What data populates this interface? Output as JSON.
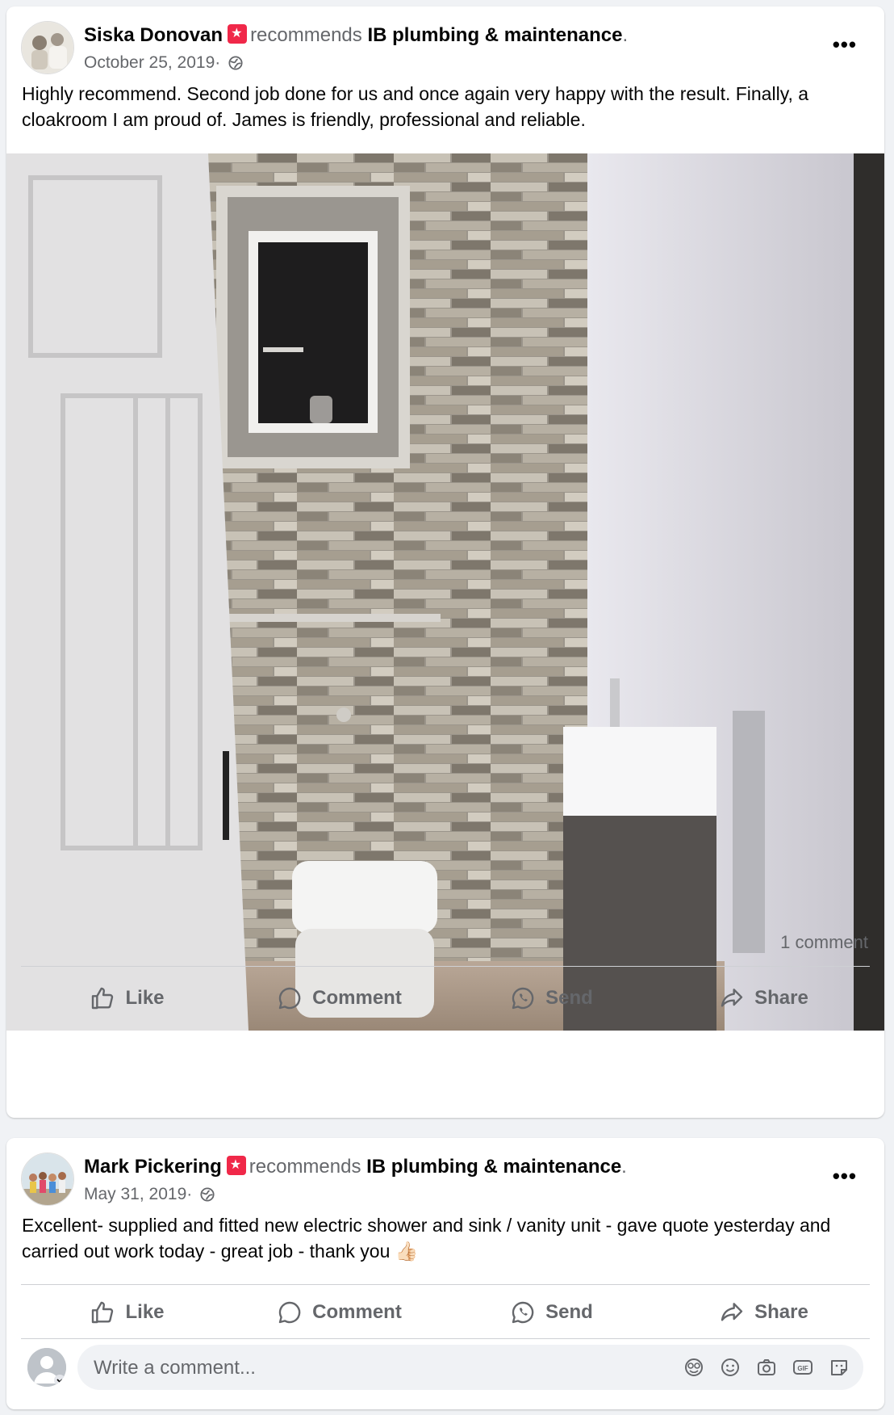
{
  "posts": [
    {
      "author": "Siska Donovan",
      "verb": "recommends",
      "page": "IB plumbing & maintenance",
      "period": ".",
      "date": "October 25, 2019·",
      "text": "Highly recommend. Second job done for us and once again very happy with the result. Finally, a cloakroom I am proud of. James is friendly, professional and reliable.",
      "comments_count": "1 comment"
    },
    {
      "author": "Mark Pickering",
      "verb": "recommends",
      "page": "IB plumbing & maintenance",
      "period": ".",
      "date": "May 31, 2019·",
      "text": "Excellent- supplied and fitted new electric shower and sink / vanity unit - gave quote yesterday and carried out work today - great job - thank you 👍🏻"
    }
  ],
  "actions": {
    "like": "Like",
    "comment": "Comment",
    "send": "Send",
    "share": "Share"
  },
  "comment_input": {
    "placeholder": "Write a comment..."
  },
  "icons": [
    "globe-icon",
    "more-options-icon",
    "like-icon",
    "comment-icon",
    "send-icon",
    "share-icon",
    "avatar-icon",
    "emoji-icon",
    "camera-icon",
    "gif-icon",
    "sticker-icon"
  ],
  "colors": {
    "recommend_badge": "#f02849",
    "muted_text": "#65676b",
    "background": "#f0f2f5"
  }
}
